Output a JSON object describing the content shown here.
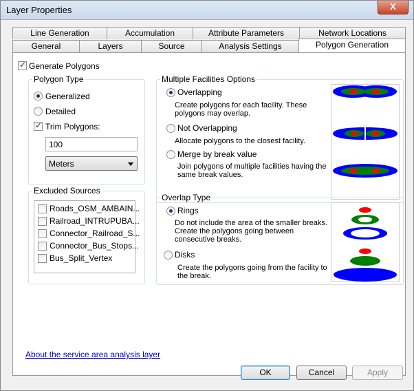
{
  "window": {
    "title": "Layer Properties",
    "close_label": "X"
  },
  "tabs_back": [
    "Line Generation",
    "Accumulation",
    "Attribute Parameters",
    "Network Locations"
  ],
  "tabs_front": [
    "General",
    "Layers",
    "Source",
    "Analysis Settings",
    "Polygon Generation"
  ],
  "generate_polygons": {
    "label": "Generate Polygons",
    "checked": true
  },
  "polygon_type": {
    "title": "Polygon Type",
    "generalized": "Generalized",
    "detailed": "Detailed",
    "trim_label": "Trim Polygons:",
    "trim_value": "100",
    "units": "Meters"
  },
  "multiple_facilities": {
    "title": "Multiple Facilities Options",
    "overlapping": "Overlapping",
    "overlapping_desc": "Create polygons for each facility. These polygons may overlap.",
    "not_overlapping": "Not Overlapping",
    "not_overlapping_desc": "Allocate polygons to the closest facility.",
    "merge": "Merge by break value",
    "merge_desc": "Join polygons of multiple facilities having the same break values."
  },
  "excluded_sources": {
    "title": "Excluded Sources",
    "items": [
      "Roads_OSM_AMBAIN...",
      "Railroad_INTRUPUBA...",
      "Connector_Railroad_S...",
      "Connector_Bus_Stops...",
      "Bus_Split_Vertex"
    ]
  },
  "overlap_type": {
    "title": "Overlap Type",
    "rings": "Rings",
    "rings_desc": "Do not include the area of the smaller breaks. Create the polygons going between consecutive breaks.",
    "disks": "Disks",
    "disks_desc": "Create the polygons going from the facility to the break."
  },
  "about_link": "About the service area analysis layer",
  "buttons": {
    "ok": "OK",
    "cancel": "Cancel",
    "apply": "Apply"
  },
  "colors": {
    "blue": "#0000ff",
    "green": "#008000",
    "red": "#ff0000"
  }
}
